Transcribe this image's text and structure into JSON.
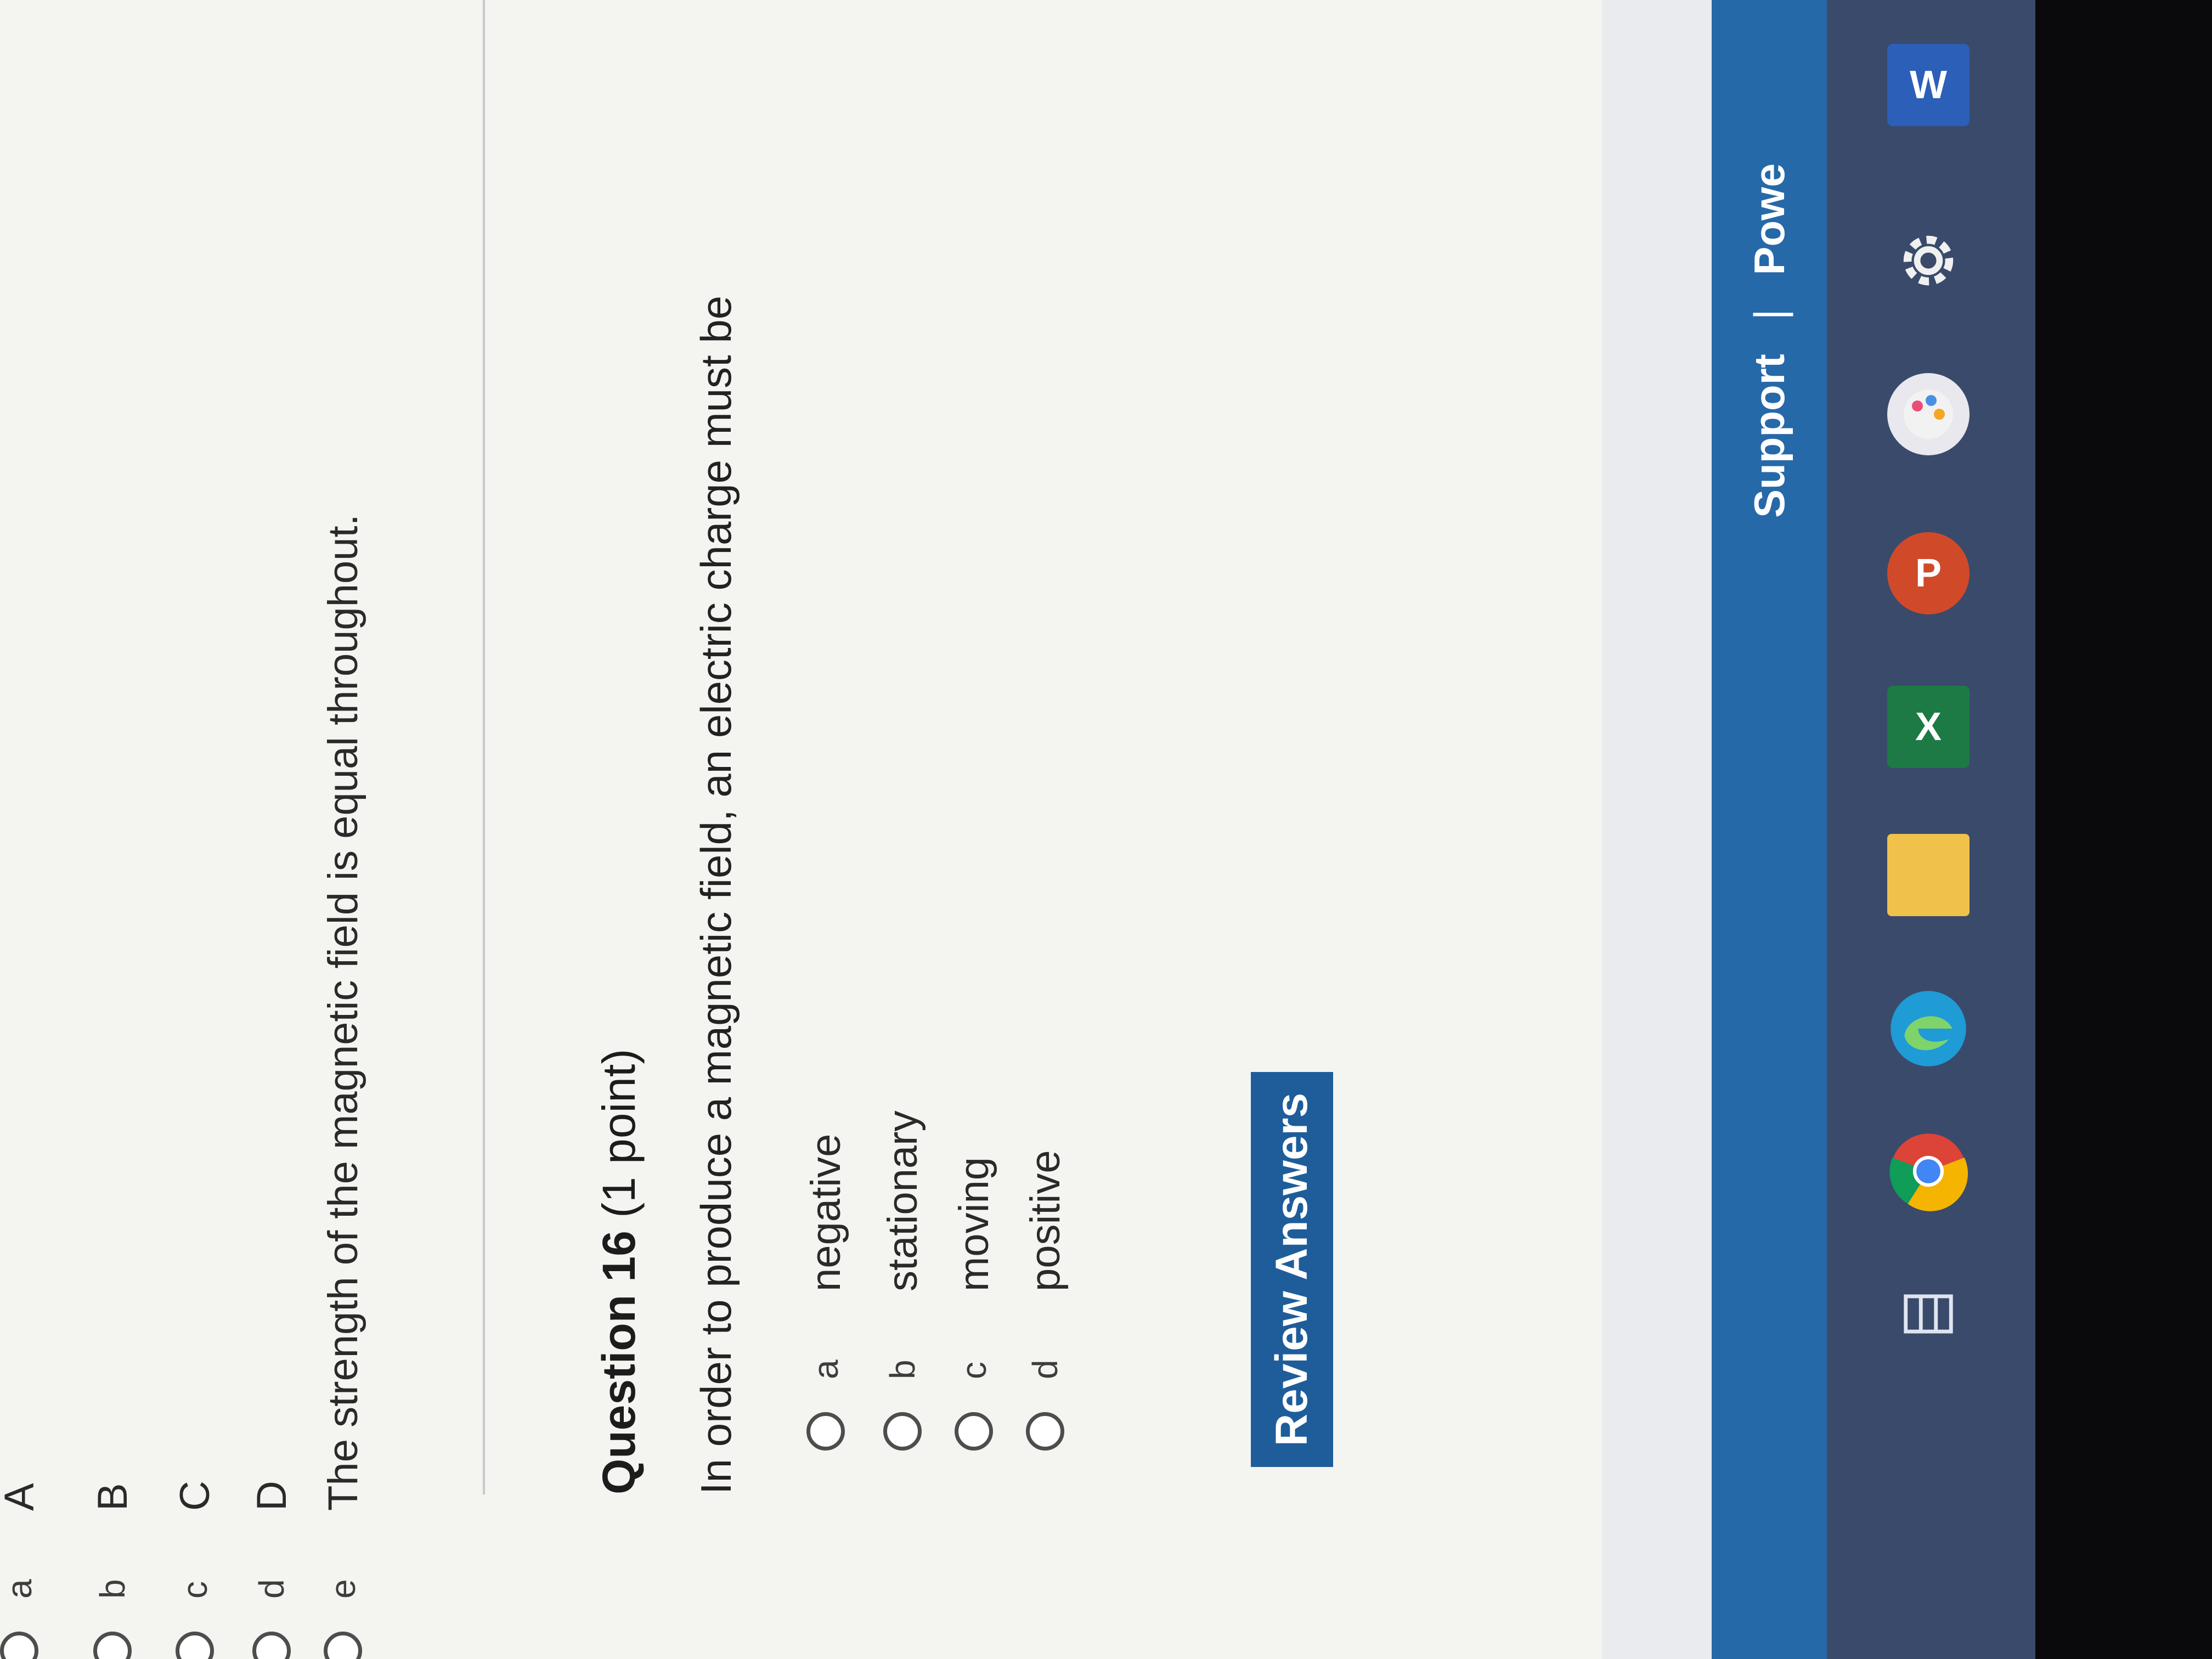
{
  "previous_question": {
    "options": [
      {
        "letter": "a",
        "text": "A"
      },
      {
        "letter": "b",
        "text": "B"
      },
      {
        "letter": "c",
        "text": "C"
      },
      {
        "letter": "d",
        "text": "D"
      },
      {
        "letter": "e",
        "text": "The strength of the magnetic field is equal throughout."
      }
    ]
  },
  "question": {
    "title": "Question 16",
    "points": "(1 point)",
    "prompt": "In order to produce a magnetic field, an electric charge must be",
    "options": [
      {
        "letter": "a",
        "text": "negative"
      },
      {
        "letter": "b",
        "text": "stationary"
      },
      {
        "letter": "c",
        "text": "moving"
      },
      {
        "letter": "d",
        "text": "positive"
      }
    ]
  },
  "review_button": "Review Answers",
  "footer": {
    "support": "Support",
    "separator": "|",
    "powered": "Powe"
  },
  "taskbar": {
    "icons": [
      "task-view-icon",
      "chrome-icon",
      "edge-icon",
      "file-explorer-icon",
      "excel-icon",
      "powerpoint-icon",
      "paint-icon",
      "settings-icon",
      "word-icon"
    ],
    "excel_letter": "X",
    "powerpoint_letter": "P",
    "word_letter": "W"
  },
  "colors": {
    "accent": "#1e5d9a",
    "footer": "#2669a9",
    "taskbar": "#3a4a6b"
  }
}
